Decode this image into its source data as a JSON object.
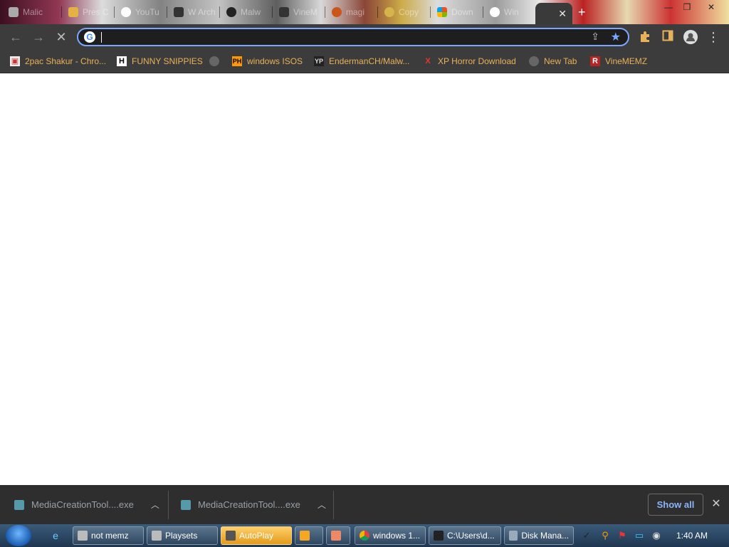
{
  "tabs": [
    {
      "title": "Malic",
      "icon": "app-icon"
    },
    {
      "title": "Pres C",
      "icon": "cat-icon"
    },
    {
      "title": "YouTu",
      "icon": "google-icon"
    },
    {
      "title": "W Arch",
      "icon": "archive-icon"
    },
    {
      "title": "Malw",
      "icon": "github-icon"
    },
    {
      "title": "VineM",
      "icon": "archive-icon"
    },
    {
      "title": "magi",
      "icon": "gear-icon"
    },
    {
      "title": "Copy",
      "icon": "copy-icon"
    },
    {
      "title": "Down",
      "icon": "microsoft-icon"
    },
    {
      "title": "Win",
      "icon": "google-icon"
    }
  ],
  "active_tab": {
    "close": "✕"
  },
  "new_tab": "+",
  "window_controls": {
    "minimize": "—",
    "maximize": "❐",
    "close": "✕"
  },
  "toolbar": {
    "back": "←",
    "forward": "→",
    "stop": "✕",
    "omnibox_value": "",
    "extensions": "puzzle-icon",
    "sidepanel": "sidepanel-icon",
    "profile": "profile-icon",
    "menu": "⋮"
  },
  "bookmarks": [
    {
      "label": "2pac Shakur - Chro...",
      "icon": "app-icon"
    },
    {
      "label": "FUNNY SNIPPIES",
      "icon": "h-icon"
    },
    {
      "label": "",
      "icon": "globe-icon"
    },
    {
      "label": "windows ISOS",
      "icon": "ph-icon"
    },
    {
      "label": "EndermanCH/Malw...",
      "icon": "yp-icon"
    },
    {
      "label": "XP Horror Download",
      "icon": "x-icon"
    },
    {
      "label": "New Tab",
      "icon": "globe-icon"
    },
    {
      "label": "VineMEMZ",
      "icon": "r-icon"
    }
  ],
  "downloads": [
    {
      "name": "MediaCreationTool....exe"
    },
    {
      "name": "MediaCreationTool....exe"
    }
  ],
  "show_all": "Show all",
  "taskbar": {
    "tasks": [
      {
        "label": "not memz"
      },
      {
        "label": "Playsets"
      },
      {
        "label": "AutoPlay"
      },
      {
        "label": ""
      },
      {
        "label": ""
      },
      {
        "label": "windows 1..."
      },
      {
        "label": "C:\\Users\\d..."
      },
      {
        "label": "Disk Mana..."
      }
    ],
    "clock": "1:40 AM"
  },
  "colors": {
    "bookmark_text": "#e8b25a",
    "omnibox_border": "#7aa7ff",
    "show_all": "#8ab4f8"
  }
}
